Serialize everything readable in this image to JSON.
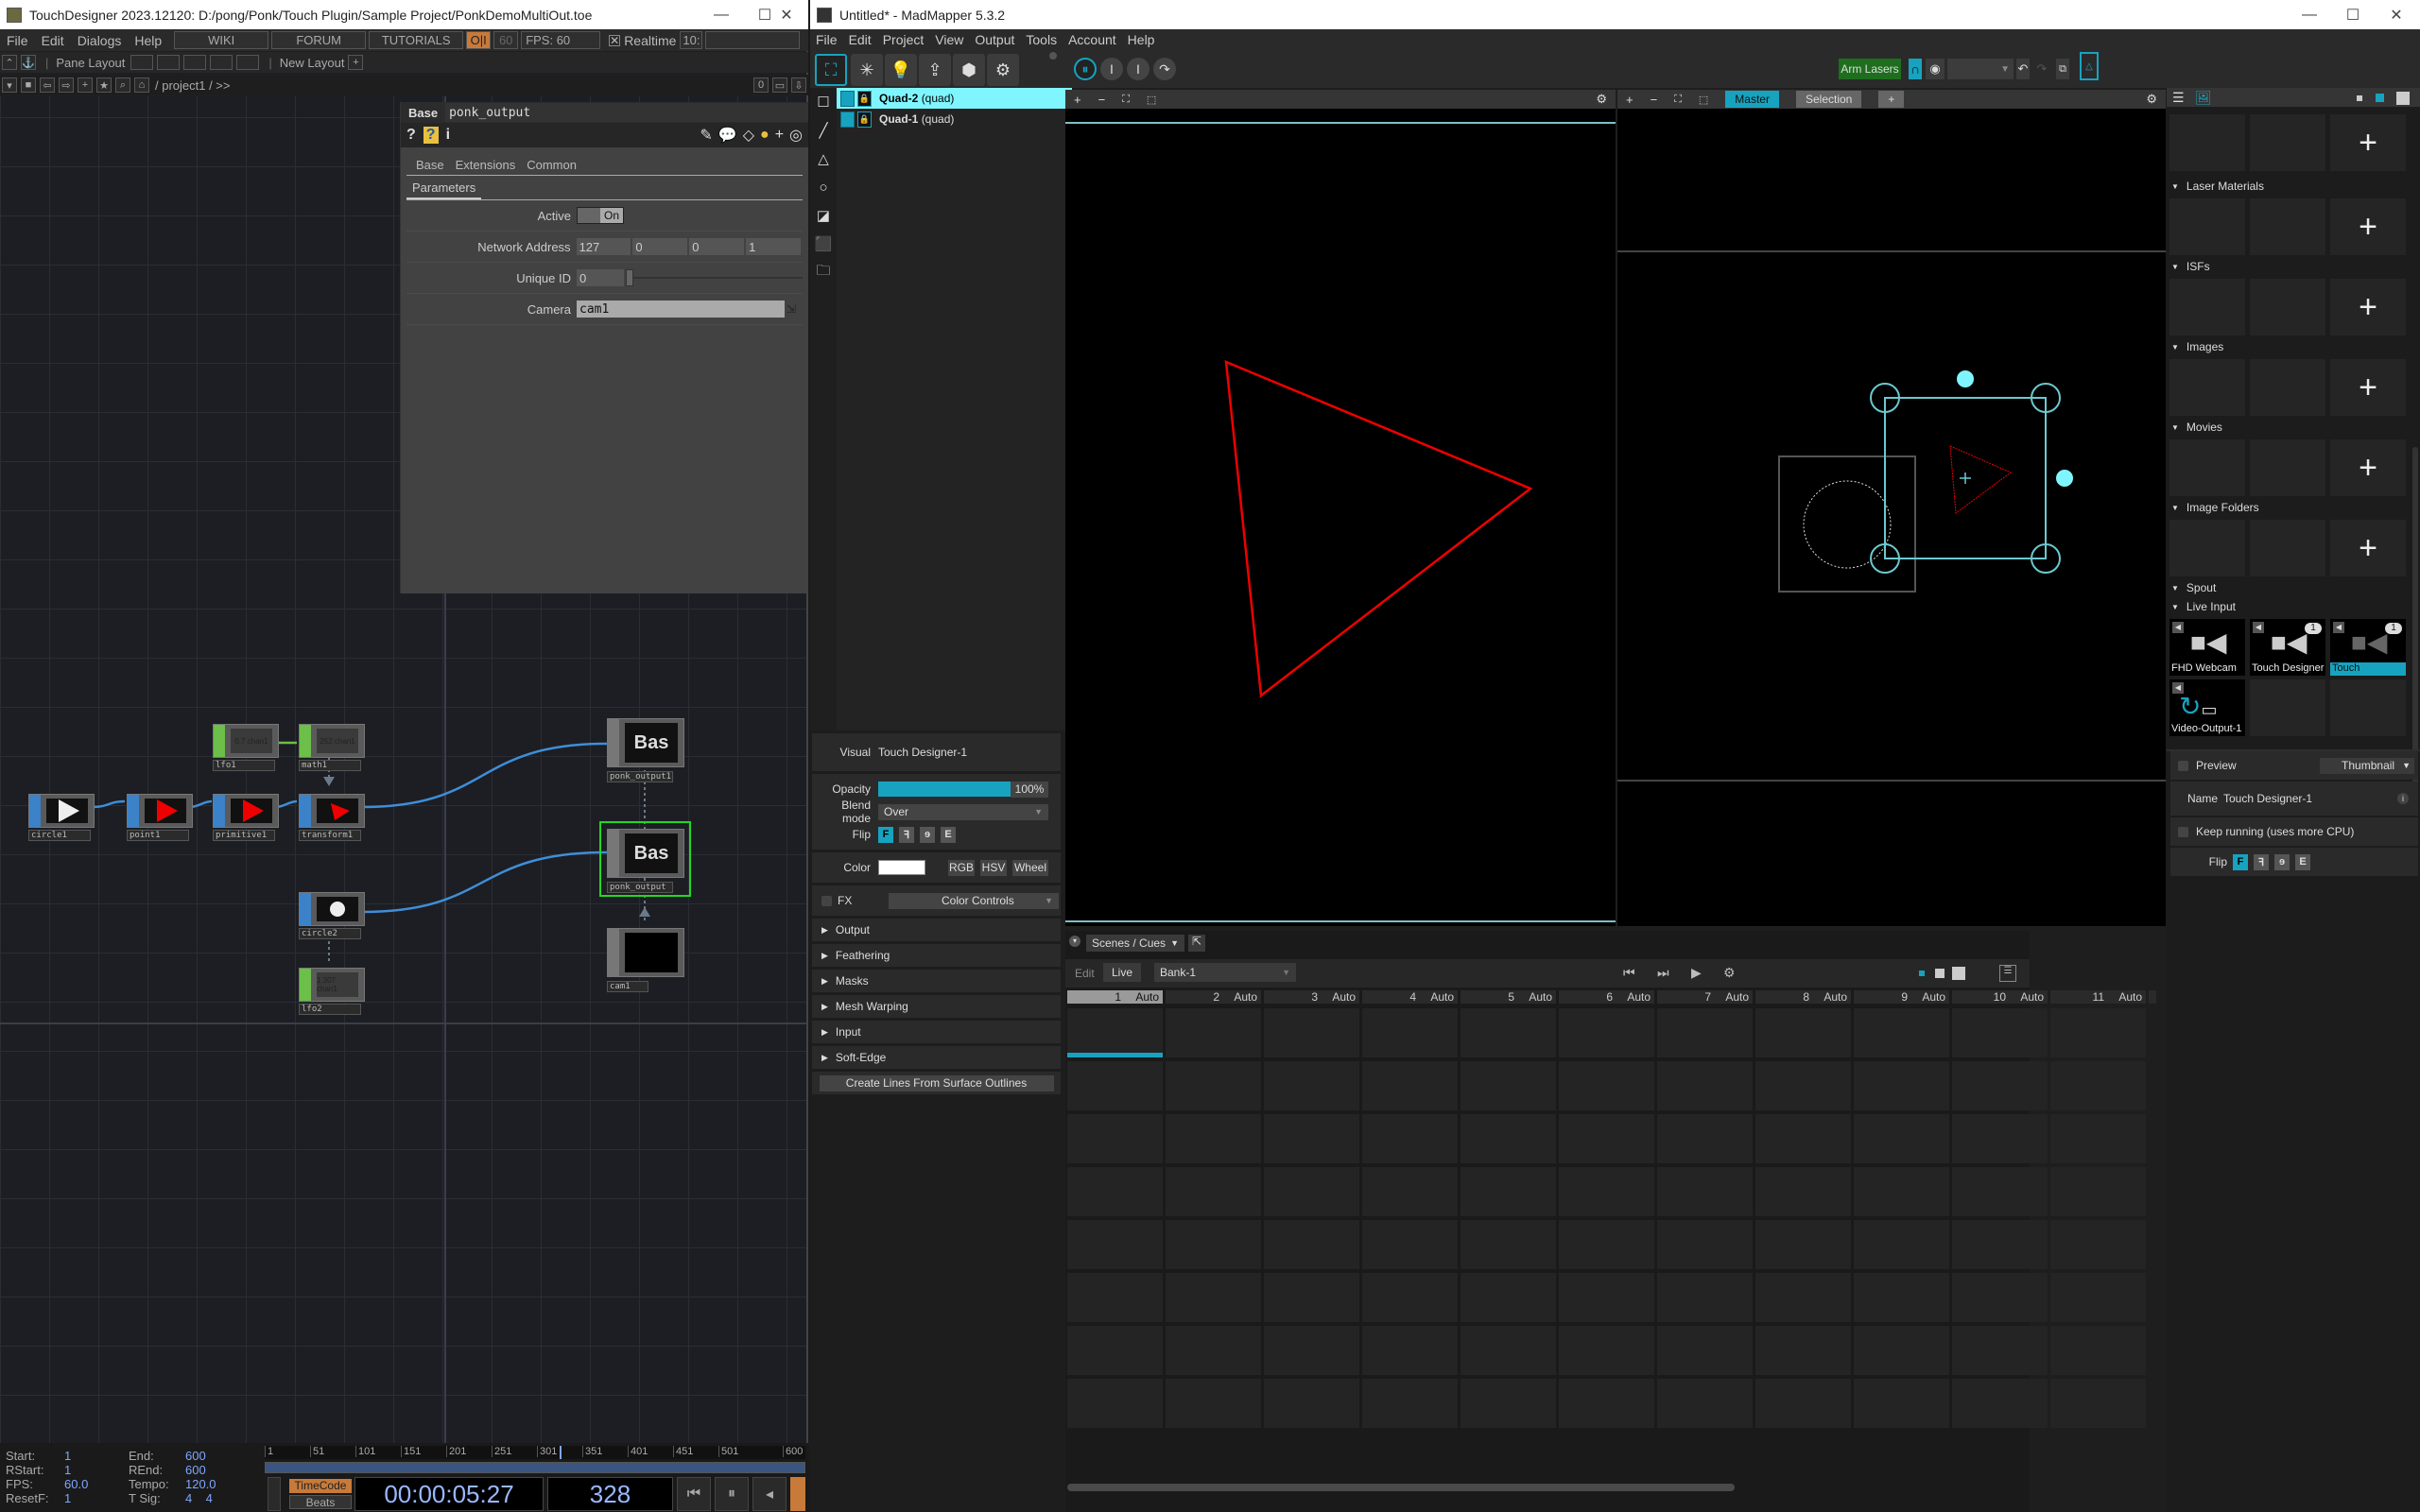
{
  "td": {
    "title": "TouchDesigner 2023.12120: D:/pong/Ponk/Touch Plugin/Sample Project/PonkDemoMultiOut.toe",
    "menu": [
      "File",
      "Edit",
      "Dialogs",
      "Help"
    ],
    "links": [
      "WIKI",
      "FORUM",
      "TUTORIALS"
    ],
    "perf_btn": "O|I",
    "fps_cap": "60",
    "fps_label": "FPS:  60",
    "realtime_label": "Realtime",
    "realtime_checked": true,
    "time_field": "10:",
    "pane_layout": "Pane Layout",
    "new_layout": "New Layout",
    "path": "/ project1 / >>",
    "path_right": "0",
    "param": {
      "type": "Base",
      "name": "ponk_output",
      "tabs": [
        "Base",
        "Extensions",
        "Common"
      ],
      "page": "Parameters",
      "active_label": "Active",
      "active_value": "On",
      "net_label": "Network Address",
      "net_values": [
        "127",
        "0",
        "0",
        "1"
      ],
      "uid_label": "Unique ID",
      "uid_value": "0",
      "uid_slider": 0.0,
      "camera_label": "Camera",
      "camera_value": "cam1"
    },
    "nodes": [
      {
        "name": "circle1",
        "type": "sop"
      },
      {
        "name": "point1",
        "type": "sop"
      },
      {
        "name": "primitive1",
        "type": "sop"
      },
      {
        "name": "transform1",
        "type": "sop"
      },
      {
        "name": "lfo1",
        "type": "chop",
        "value": "0.7 chan1"
      },
      {
        "name": "math1",
        "type": "chop",
        "value": "252 chan1"
      },
      {
        "name": "circle2",
        "type": "sop"
      },
      {
        "name": "lfo2",
        "type": "chop",
        "value": "1.307 chan1"
      },
      {
        "name": "ponk_output1",
        "type": "comp",
        "value": "Bas"
      },
      {
        "name": "ponk_output",
        "type": "comp",
        "value": "Bas"
      },
      {
        "name": "cam1",
        "type": "comp"
      }
    ],
    "timeline": {
      "start_label": "Start:",
      "start": "1",
      "end_label": "End:",
      "end": "600",
      "rstart_label": "RStart:",
      "rstart": "1",
      "rend_label": "REnd:",
      "rend": "600",
      "fps_label": "FPS:",
      "fps": "60.0",
      "tempo_label": "Tempo:",
      "tempo": "120.0",
      "resetf_label": "ResetF:",
      "resetf": "1",
      "tsig_label": "T Sig:",
      "tsig": "4    4",
      "ruler": [
        "1",
        "51",
        "101",
        "151",
        "201",
        "251",
        "301",
        "351",
        "401",
        "451",
        "501",
        "600"
      ],
      "timecode_btn": "TimeCode",
      "beats_btn": "Beats",
      "timecode": "00:00:05:27",
      "frame": "328"
    }
  },
  "mm": {
    "title": "Untitled* - MadMapper 5.3.2",
    "menu": [
      "File",
      "Edit",
      "Project",
      "View",
      "Output",
      "Tools",
      "Account",
      "Help"
    ],
    "arm_lasers": "Arm Lasers",
    "surfaces": [
      {
        "name": "Quad-2",
        "type": "(quad)",
        "selected": true
      },
      {
        "name": "Quad-1",
        "type": "(quad)",
        "selected": false
      }
    ],
    "view_tabs": [
      "Master",
      "Selection",
      "+"
    ],
    "visual_label": "Visual",
    "visual_value": "Touch Designer-1",
    "opacity_label": "Opacity",
    "opacity_value": "100%",
    "opacity": 1.0,
    "blend_label": "Blend mode",
    "blend_value": "Over",
    "flip_label": "Flip",
    "flip_btns": [
      "F",
      "ꟻ",
      "ɘ",
      "E"
    ],
    "color_label": "Color",
    "color_value": "#ffffff",
    "color_modes": [
      "RGB",
      "HSV",
      "Wheel"
    ],
    "fx_label": "FX",
    "fx_value": "Color Controls",
    "sections": [
      "Output",
      "Feathering",
      "Masks",
      "Mesh Warping",
      "Input",
      "Soft-Edge"
    ],
    "create_lines": "Create Lines From Surface Outlines",
    "scenes_dd": "Scenes / Cues",
    "edit_label": "Edit",
    "live_label": "Live",
    "bank": "Bank-1",
    "cues": [
      {
        "n": "1",
        "mode": "Auto"
      },
      {
        "n": "2",
        "mode": "Auto"
      },
      {
        "n": "3",
        "mode": "Auto"
      },
      {
        "n": "4",
        "mode": "Auto"
      },
      {
        "n": "5",
        "mode": "Auto"
      },
      {
        "n": "6",
        "mode": "Auto"
      },
      {
        "n": "7",
        "mode": "Auto"
      },
      {
        "n": "8",
        "mode": "Auto"
      },
      {
        "n": "9",
        "mode": "Auto"
      },
      {
        "n": "10",
        "mode": "Auto"
      },
      {
        "n": "11",
        "mode": "Auto"
      }
    ],
    "library": {
      "sections": [
        "Laser Materials",
        "ISFs",
        "Images",
        "Movies",
        "Image Folders",
        "Spout",
        "Live Input"
      ],
      "live_inputs": [
        {
          "name": "FHD Webcam",
          "badge": ""
        },
        {
          "name": "Touch Designer",
          "badge": "1"
        },
        {
          "name": "Touch",
          "badge": "1",
          "selected": true
        },
        {
          "name": "Video-Output-1",
          "badge": ""
        }
      ],
      "preview_label": "Preview",
      "preview_mode": "Thumbnail",
      "name_label": "Name",
      "name_value": "Touch Designer-1",
      "keep_running": "Keep running (uses more CPU)",
      "flip_label": "Flip"
    },
    "accent": "#17a3bf"
  }
}
